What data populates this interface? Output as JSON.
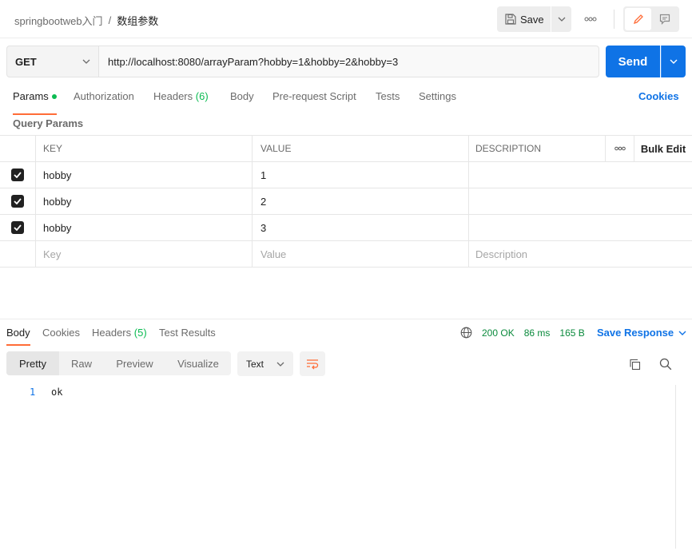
{
  "header": {
    "breadcrumb_parent": "springbootweb入门",
    "breadcrumb_sep": "/",
    "breadcrumb_current": "数组参数",
    "save_label": "Save"
  },
  "request": {
    "method": "GET",
    "url": "http://localhost:8080/arrayParam?hobby=1&hobby=2&hobby=3",
    "send_label": "Send"
  },
  "tabs": [
    {
      "label": "Params",
      "count": ""
    },
    {
      "label": "Authorization",
      "count": ""
    },
    {
      "label": "Headers",
      "count": "(6)"
    },
    {
      "label": "Body",
      "count": ""
    },
    {
      "label": "Pre-request Script",
      "count": ""
    },
    {
      "label": "Tests",
      "count": ""
    },
    {
      "label": "Settings",
      "count": ""
    }
  ],
  "cookies_label": "Cookies",
  "query_params": {
    "title": "Query Params",
    "headers": {
      "key": "KEY",
      "value": "VALUE",
      "description": "DESCRIPTION",
      "bulk_edit": "Bulk Edit"
    },
    "rows": [
      {
        "key": "hobby",
        "value": "1",
        "description": ""
      },
      {
        "key": "hobby",
        "value": "2",
        "description": ""
      },
      {
        "key": "hobby",
        "value": "3",
        "description": ""
      }
    ],
    "placeholders": {
      "key": "Key",
      "value": "Value",
      "description": "Description"
    }
  },
  "response": {
    "tabs": [
      {
        "label": "Body",
        "count": ""
      },
      {
        "label": "Cookies",
        "count": ""
      },
      {
        "label": "Headers",
        "count": "(5)"
      },
      {
        "label": "Test Results",
        "count": ""
      }
    ],
    "status": "200 OK",
    "time": "86 ms",
    "size": "165 B",
    "save_response": "Save Response",
    "views": [
      "Pretty",
      "Raw",
      "Preview",
      "Visualize"
    ],
    "format": "Text",
    "lines": [
      {
        "num": "1",
        "text": "ok"
      }
    ]
  },
  "colors": {
    "accent": "#ff6c37",
    "primary": "#0f73e6",
    "success": "#0cbb52"
  }
}
